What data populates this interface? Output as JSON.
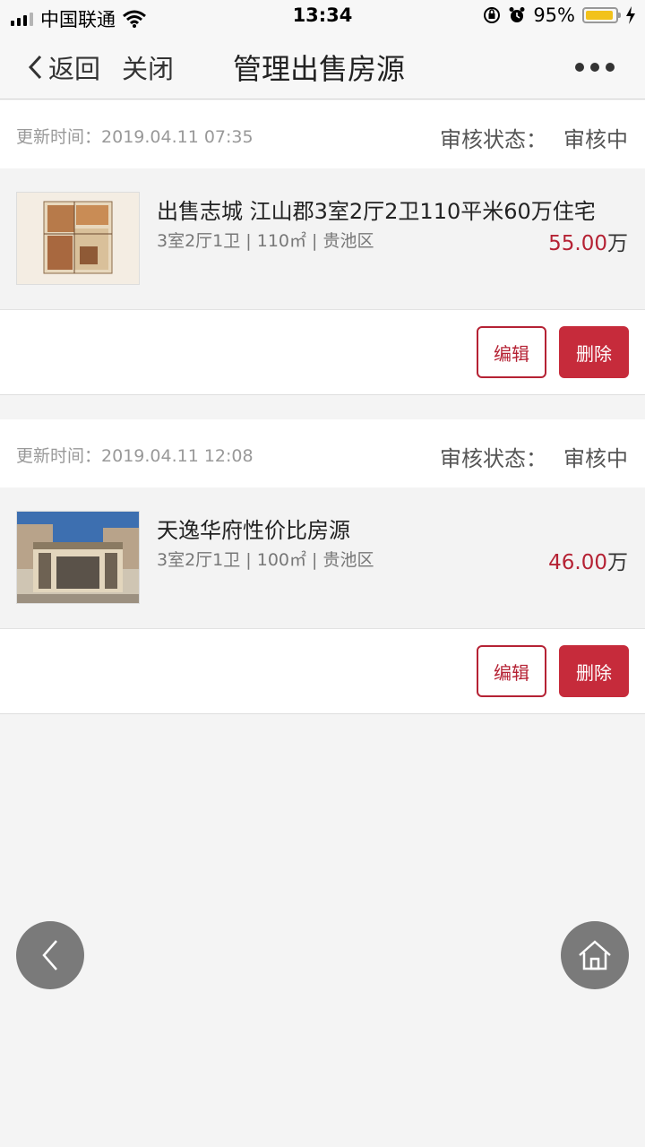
{
  "status_bar": {
    "carrier": "中国联通",
    "time": "13:34",
    "battery": "95%",
    "battery_level": 0.95
  },
  "nav": {
    "back": "返回",
    "close": "关闭",
    "title": "管理出售房源"
  },
  "listings": [
    {
      "update_label": "更新时间：",
      "update_time": "2019.04.11 07:35",
      "audit_label": "审核状态：",
      "audit_value": "审核中",
      "title": "出售志城 江山郡3室2厅2卫110平米60万住宅",
      "info": "3室2厅1卫 | 110㎡ | 贵池区",
      "price": "55.00",
      "price_unit": "万",
      "edit": "编辑",
      "delete": "删除"
    },
    {
      "update_label": "更新时间：",
      "update_time": "2019.04.11 12:08",
      "audit_label": "审核状态：",
      "audit_value": "审核中",
      "title": "天逸华府性价比房源",
      "info": "3室2厅1卫 | 100㎡ | 贵池区",
      "price": "46.00",
      "price_unit": "万",
      "edit": "编辑",
      "delete": "删除"
    }
  ],
  "colors": {
    "accent": "#c62b3b",
    "price": "#b52234",
    "background": "#f4f4f4"
  },
  "icons": {
    "back": "chevron-left-icon",
    "more": "more-dots-icon",
    "float_back": "arrow-left-icon",
    "float_home": "home-icon"
  }
}
